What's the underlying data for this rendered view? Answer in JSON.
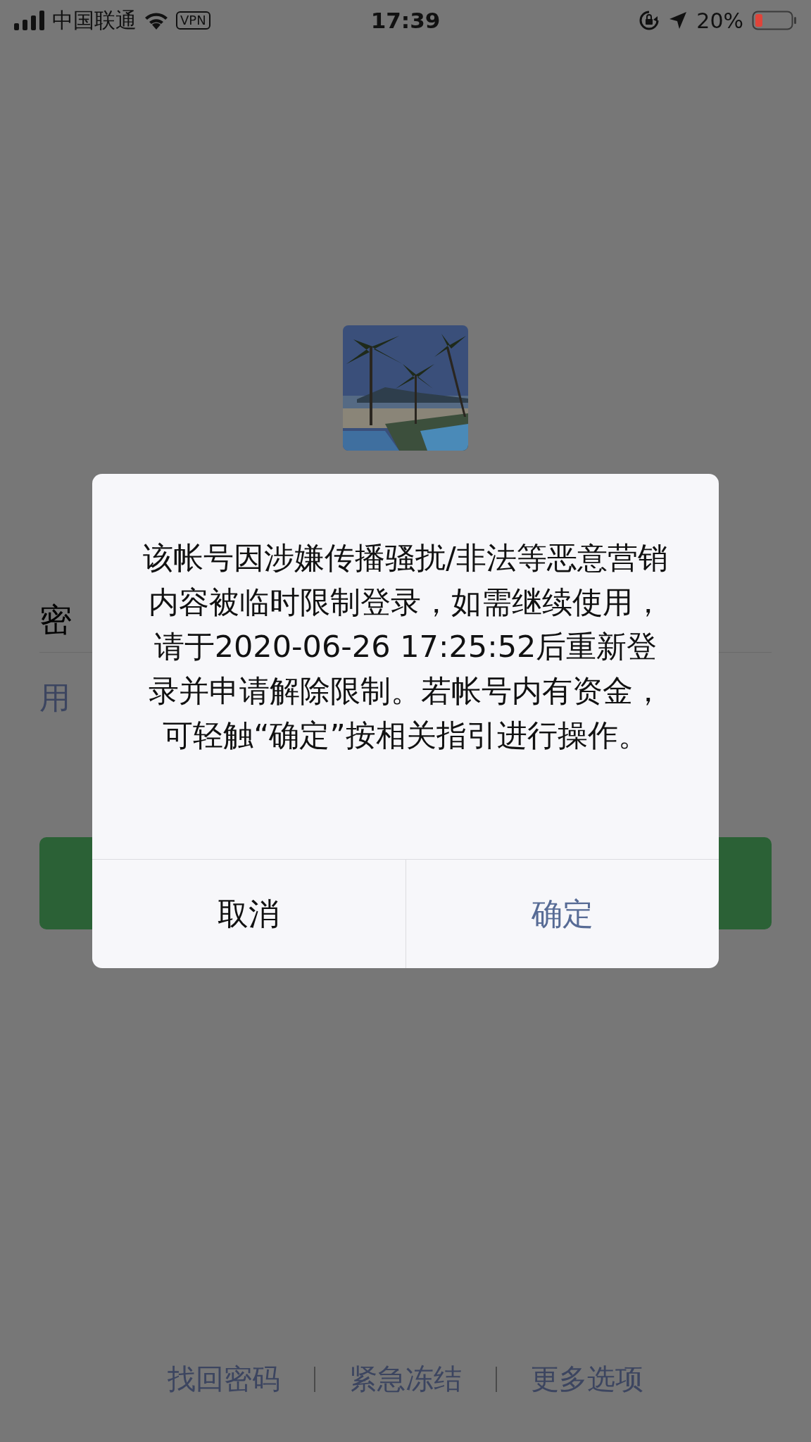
{
  "status_bar": {
    "carrier": "中国联通",
    "vpn": "VPN",
    "time": "17:39",
    "battery": "20%"
  },
  "password_row": {
    "label": "密"
  },
  "sms_login_link": "用",
  "login_button": {
    "kind": "primary"
  },
  "footer_links": [
    "找回密码",
    "紧急冻结",
    "更多选项"
  ],
  "dialog": {
    "message": "该帐号因涉嫌传播骚扰/非法等恶意营销内容被临时限制登录，如需继续使用，请于2020-06-26 17:25:52后重新登录并申请解除限制。若帐号内有资金，可轻触“确定”按相关指引进行操作。",
    "buttons": [
      {
        "label": "取消",
        "kind": "cancel"
      },
      {
        "label": "确定",
        "kind": "confirm"
      }
    ]
  }
}
